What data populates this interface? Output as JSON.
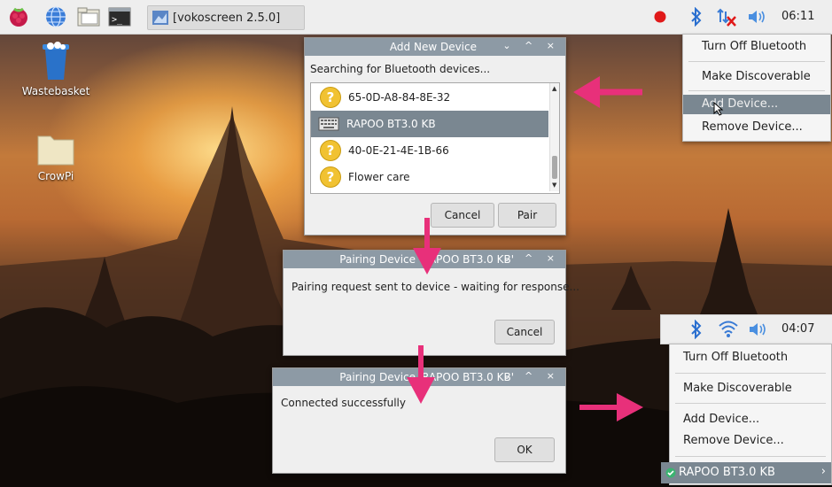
{
  "taskbar": {
    "app_button_label": "[vokoscreen 2.5.0]",
    "clock": "06:11",
    "icons": [
      "raspberry-menu-icon",
      "web-browser-icon",
      "file-manager-icon",
      "terminal-icon",
      "vokoscreen-icon"
    ],
    "tray_icons": [
      "record-icon",
      "bluetooth-icon",
      "network-disconnected-icon",
      "volume-icon"
    ]
  },
  "desktop": {
    "icons": [
      {
        "label": "Wastebasket",
        "icon": "trash-icon"
      },
      {
        "label": "CrowPi",
        "icon": "folder-icon"
      }
    ]
  },
  "bt_menu_top": {
    "items": [
      "Turn Off Bluetooth",
      "Make Discoverable",
      "Add Device...",
      "Remove Device..."
    ],
    "highlighted": "Add Device..."
  },
  "add_device_dialog": {
    "title": "Add New Device",
    "status": "Searching for Bluetooth devices...",
    "devices": [
      {
        "name": "65-0D-A8-84-8E-32",
        "icon": "unknown-device-icon"
      },
      {
        "name": "RAPOO BT3.0 KB",
        "icon": "keyboard-icon",
        "selected": true
      },
      {
        "name": "40-0E-21-4E-1B-66",
        "icon": "unknown-device-icon"
      },
      {
        "name": "Flower care",
        "icon": "unknown-device-icon"
      }
    ],
    "cancel_label": "Cancel",
    "pair_label": "Pair"
  },
  "pairing_dialog": {
    "title": "Pairing Device 'RAPOO BT3.0 KB'",
    "message": "Pairing request sent to device - waiting for response...",
    "cancel_label": "Cancel"
  },
  "connected_dialog": {
    "title": "Pairing Device 'RAPOO BT3.0 KB'",
    "message": "Connected successfully",
    "ok_label": "OK"
  },
  "bt_menu_bottom": {
    "clock": "04:07",
    "tray_icons": [
      "bluetooth-icon",
      "wifi-icon",
      "volume-icon"
    ],
    "items": [
      "Turn Off Bluetooth",
      "Make Discoverable",
      "Add Device...",
      "Remove Device..."
    ],
    "connected_device": "RAPOO BT3.0 KB"
  },
  "colors": {
    "accent_pink": "#e8307a",
    "selection": "#7a8791",
    "titlebar": "#8d9aa5",
    "question": "#f1c232"
  }
}
